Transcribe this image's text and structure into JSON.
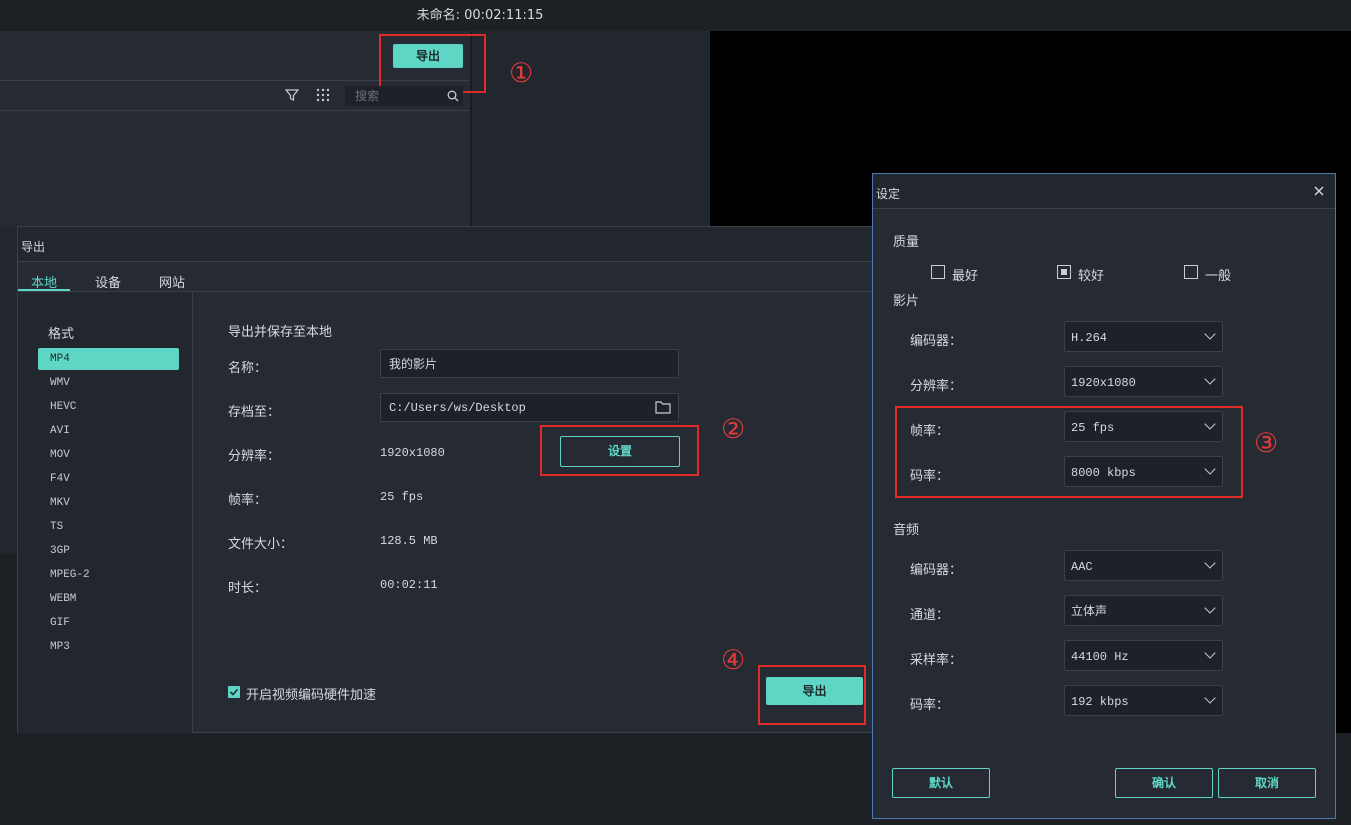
{
  "app": {
    "title": "未命名: 00:02:11:15",
    "export_label": "导出",
    "search_placeholder": "搜索"
  },
  "annotations": {
    "n1": "①",
    "n2": "②",
    "n3": "③",
    "n4": "④"
  },
  "export_dialog": {
    "title": "导出",
    "tabs": [
      "本地",
      "设备",
      "网站"
    ],
    "format_header": "格式",
    "formats": [
      "MP4",
      "WMV",
      "HEVC",
      "AVI",
      "MOV",
      "F4V",
      "MKV",
      "TS",
      "3GP",
      "MPEG-2",
      "WEBM",
      "GIF",
      "MP3"
    ],
    "section_title": "导出并保存至本地",
    "name_label": "名称：",
    "name_value": "我的影片",
    "save_label": "存档至：",
    "save_value": "C:/Users/ws/Desktop",
    "res_label": "分辨率：",
    "res_value": "1920x1080",
    "settings_button": "设置",
    "fps_label": "帧率：",
    "fps_value": "25 fps",
    "size_label": "文件大小：",
    "size_value": "128.5 MB",
    "dur_label": "时长：",
    "dur_value": "00:02:11",
    "hw_accel_label": "开启视频编码硬件加速",
    "export_button": "导出"
  },
  "settings_dialog": {
    "title": "设定",
    "quality_label": "质量",
    "quality_options": [
      "最好",
      "较好",
      "一般"
    ],
    "video_label": "影片",
    "v_encoder_label": "编码器：",
    "v_encoder_value": "H.264",
    "v_res_label": "分辨率：",
    "v_res_value": "1920x1080",
    "v_fps_label": "帧率：",
    "v_fps_value": "25 fps",
    "v_bitrate_label": "码率：",
    "v_bitrate_value": "8000 kbps",
    "audio_label": "音频",
    "a_encoder_label": "编码器：",
    "a_encoder_value": "AAC",
    "a_channel_label": "通道：",
    "a_channel_value": "立体声",
    "a_sample_label": "采样率：",
    "a_sample_value": "44100 Hz",
    "a_bitrate_label": "码率：",
    "a_bitrate_value": "192 kbps",
    "default_button": "默认",
    "ok_button": "确认",
    "cancel_button": "取消"
  },
  "colors": {
    "accent": "#5fd6c5",
    "annotation_red": "#e02b2b",
    "dialog_border": "#4b7ab3"
  },
  "icons": [
    "filter-icon",
    "grid-icon",
    "search-icon",
    "folder-icon",
    "close-icon",
    "chevron-down-icon"
  ]
}
